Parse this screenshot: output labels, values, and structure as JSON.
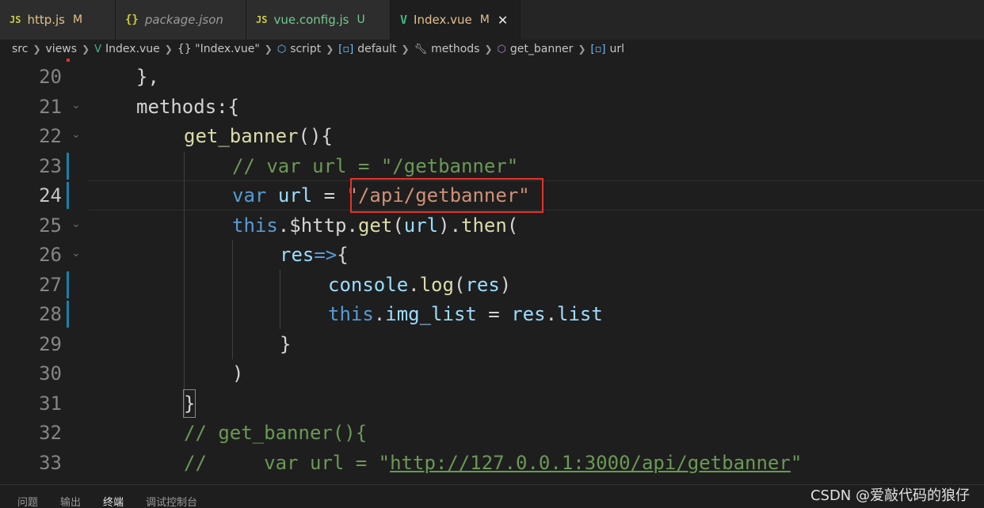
{
  "tabs": [
    {
      "icon": "JS",
      "label": "http.js",
      "badge": "M",
      "state": "modified"
    },
    {
      "icon": "{}",
      "label": "package.json",
      "badge": "",
      "state": "normal"
    },
    {
      "icon": "JS",
      "label": "vue.config.js",
      "badge": "U",
      "state": "untracked"
    },
    {
      "icon": "V",
      "label": "Index.vue",
      "badge": "M",
      "state": "active"
    }
  ],
  "breadcrumb": [
    "src",
    "views",
    "Index.vue",
    "{} \"Index.vue\"",
    "script",
    "default",
    "methods",
    "get_banner",
    "url"
  ],
  "code": {
    "lines": [
      "20",
      "21",
      "22",
      "23",
      "24",
      "25",
      "26",
      "27",
      "28",
      "29",
      "30",
      "31",
      "32",
      "33"
    ],
    "l20": "},",
    "l21": "methods:{",
    "l22_fn": "get_banner",
    "l22_rest": "(){",
    "l23": "// var url = \"/getbanner\"",
    "l24_kw": "var",
    "l24_var": "url",
    "l24_eq": " = ",
    "l24_str": "\"/api/getbanner\"",
    "l25_this": "this",
    "l25_a": ".$http.",
    "l25_get": "get",
    "l25_b": "(",
    "l25_url": "url",
    "l25_c": ").",
    "l25_then": "then",
    "l25_d": "(",
    "l26_res": "res",
    "l26_arrow": "=>",
    "l26_brace": "{",
    "l27_console": "console",
    "l27_dot": ".",
    "l27_log": "log",
    "l27_paren": "(",
    "l27_res": "res",
    "l27_close": ")",
    "l28_this": "this",
    "l28_dot": ".",
    "l28_img": "img_list",
    "l28_eq": " = ",
    "l28_res": "res",
    "l28_dot2": ".",
    "l28_list": "list",
    "l29": "}",
    "l30": ")",
    "l31": "}",
    "l32": "// get_banner(){",
    "l33_a": "//     var url = \"",
    "l33_link": "http://127.0.0.1:3000/api/getbanner",
    "l33_b": "\""
  },
  "panel_tabs": [
    "问题",
    "输出",
    "终端",
    "调试控制台"
  ],
  "active_panel_tab": "终端",
  "watermark": "CSDN @爱敲代码的狼仔",
  "colors": {
    "highlight_box": "#e5332a",
    "keyword": "#569cd6",
    "string": "#ce9178",
    "comment": "#6a9955",
    "function": "#dcdcaa",
    "variable": "#9cdcfe"
  }
}
